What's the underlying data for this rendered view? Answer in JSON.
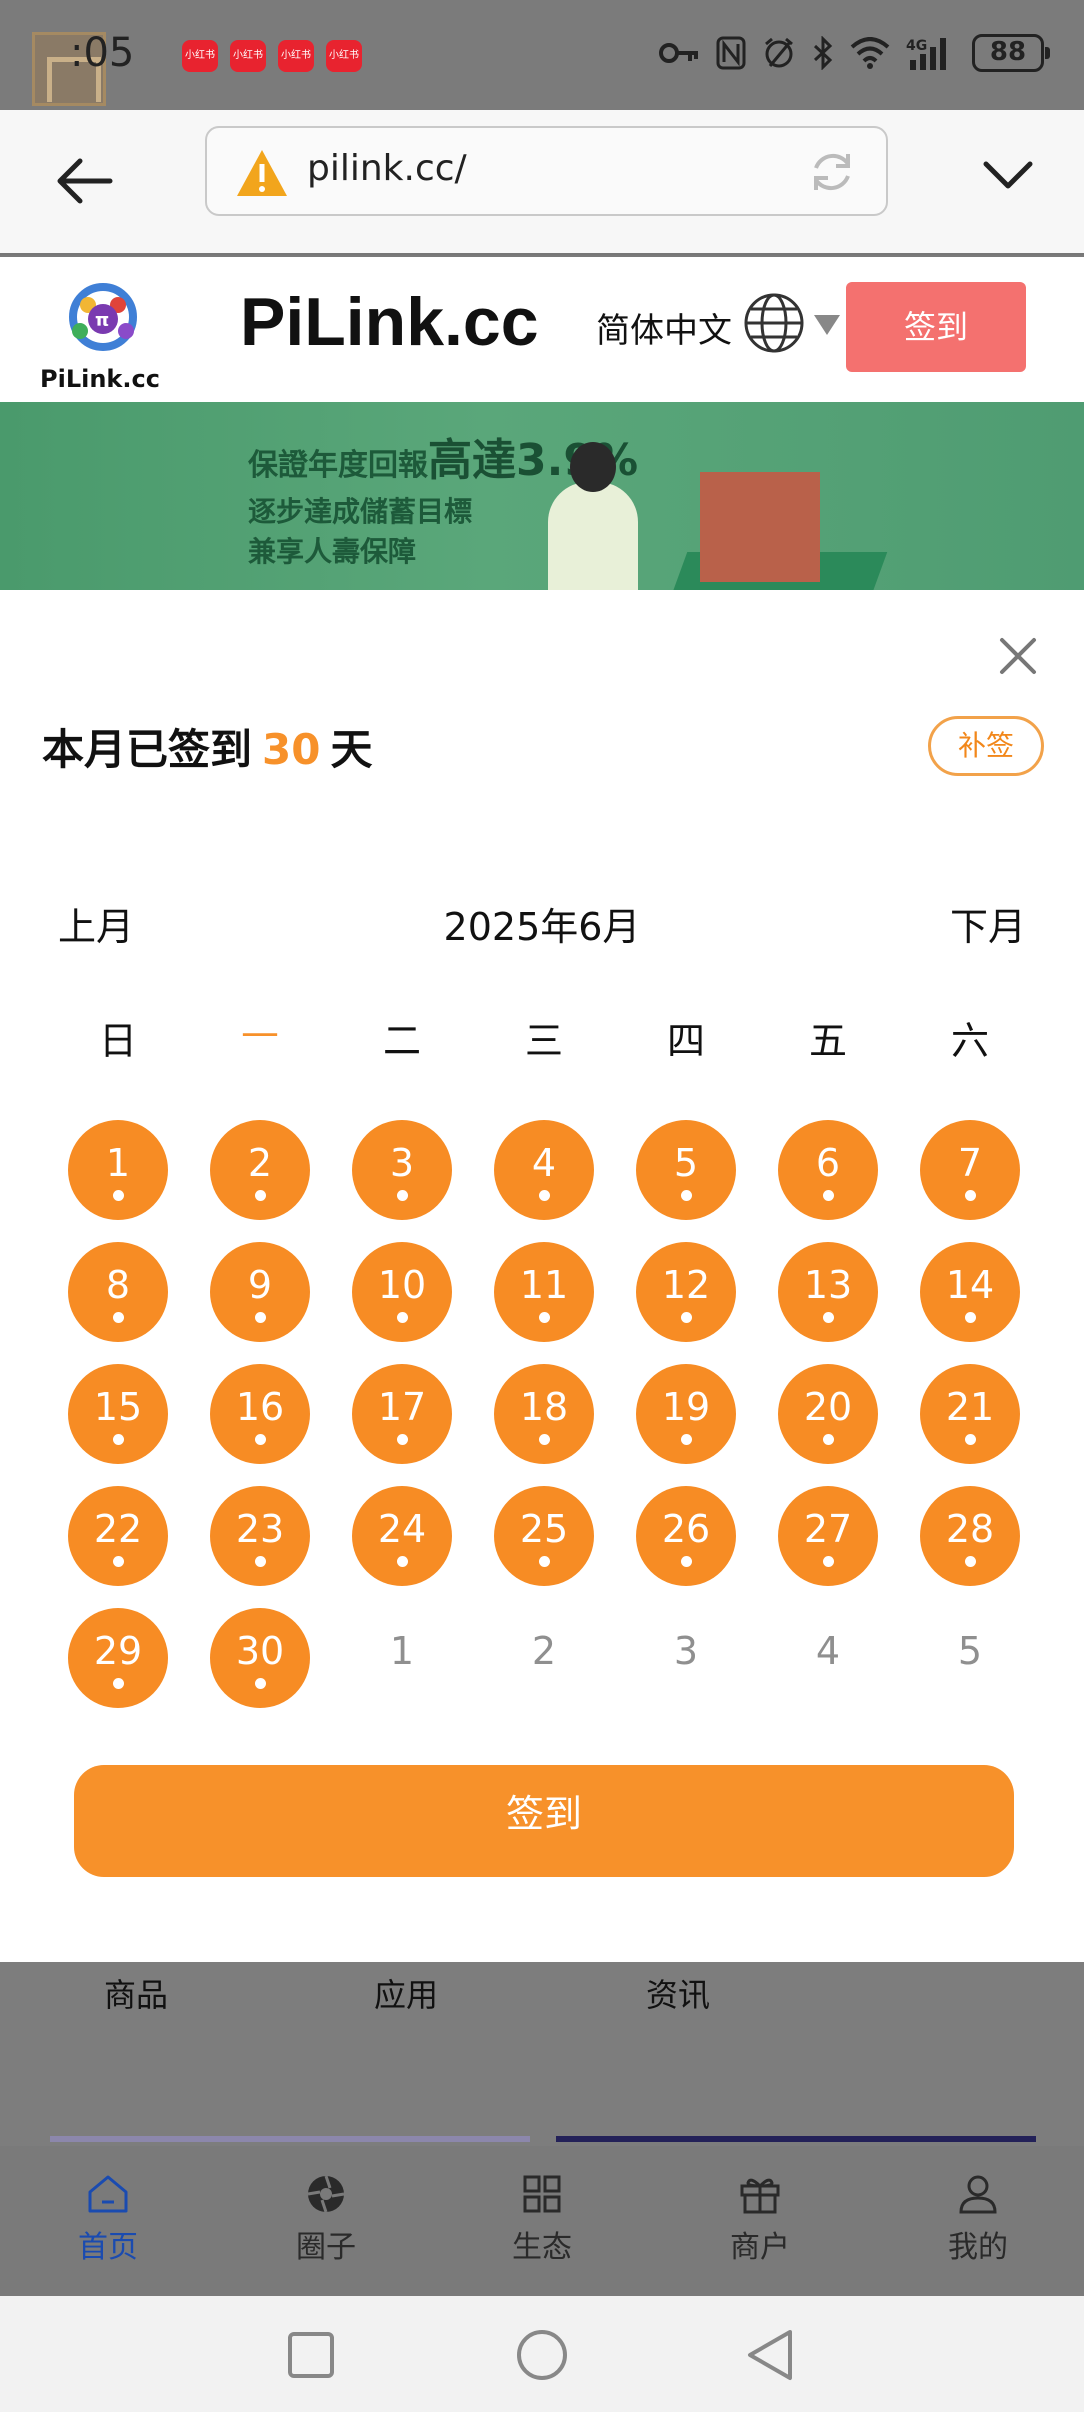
{
  "status_bar": {
    "time": ":05",
    "notification_badge": "小红书",
    "battery": "88"
  },
  "browser": {
    "url": "pilink.cc/"
  },
  "site": {
    "logo_text": "PiLink.cc",
    "title": "PiLink.cc",
    "language": "简体中文",
    "signin_label": "签到"
  },
  "banner": {
    "line1_prefix": "保證年度回報",
    "line1_highlight": "高達3.9%",
    "line2": "逐步達成儲蓄目標",
    "line3": "兼享人壽保障"
  },
  "modal": {
    "signed_prefix": "本月已签到",
    "signed_count": "30",
    "signed_suffix": "天",
    "makeup_label": "补签",
    "prev_month": "上月",
    "month_label": "2025年6月",
    "next_month": "下月",
    "weekdays": [
      "日",
      "一",
      "二",
      "三",
      "四",
      "五",
      "六"
    ],
    "active_weekday_index": 1,
    "days_signed": [
      "1",
      "2",
      "3",
      "4",
      "5",
      "6",
      "7",
      "8",
      "9",
      "10",
      "11",
      "12",
      "13",
      "14",
      "15",
      "16",
      "17",
      "18",
      "19",
      "20",
      "21",
      "22",
      "23",
      "24",
      "25",
      "26",
      "27",
      "28",
      "29",
      "30"
    ],
    "days_next_month": [
      "1",
      "2",
      "3",
      "4",
      "5"
    ],
    "sign_button_label": "签到"
  },
  "underlying_tabs": [
    "商品",
    "应用",
    "资讯"
  ],
  "app_nav": [
    {
      "label": "首页",
      "icon": "home-icon",
      "active": true
    },
    {
      "label": "圈子",
      "icon": "aperture-icon",
      "active": false
    },
    {
      "label": "生态",
      "icon": "grid-icon",
      "active": false
    },
    {
      "label": "商户",
      "icon": "gift-icon",
      "active": false
    },
    {
      "label": "我的",
      "icon": "user-icon",
      "active": false
    }
  ],
  "colors": {
    "accent_orange": "#f78c24",
    "signin_red": "#f4716f",
    "nav_active_blue": "#1a4bb0"
  }
}
